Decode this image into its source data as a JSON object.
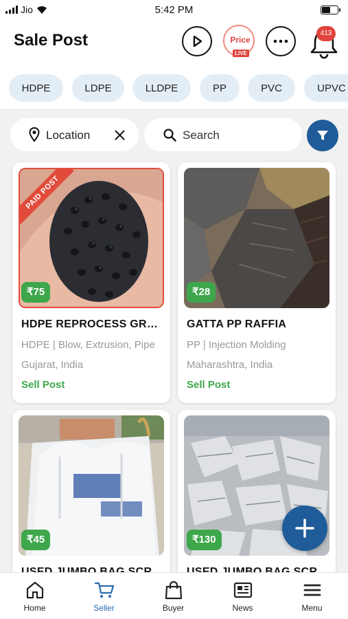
{
  "status_bar": {
    "carrier": "Jio",
    "time": "5:42 PM"
  },
  "header": {
    "title": "Sale Post",
    "price_live": {
      "label": "Price",
      "badge": "LIVE"
    },
    "notification_count": "413"
  },
  "categories": [
    "HDPE",
    "LDPE",
    "LLDPE",
    "PP",
    "PVC",
    "UPVC"
  ],
  "filters": {
    "location_label": "Location",
    "search_label": "Search"
  },
  "posts": [
    {
      "price": "₹75",
      "title": "HDPE REPROCESS GRANULES",
      "subtitle": "HDPE | Blow, Extrusion, Pipe",
      "location": "Gujarat, India",
      "type": "Sell Post",
      "ribbon": "PAID POST"
    },
    {
      "price": "₹28",
      "title": "GATTA PP RAFFIA",
      "subtitle": "PP | Injection Molding",
      "location": "Maharashtra, India",
      "type": "Sell Post"
    },
    {
      "price": "₹45",
      "title": "USED JUMBO BAG SCRAP"
    },
    {
      "price": "₹130",
      "title": "USED JUMBO BAG SCRAP"
    }
  ],
  "bottom_nav": [
    {
      "label": "Home",
      "icon": "home-icon"
    },
    {
      "label": "Seller",
      "icon": "cart-icon",
      "active": true
    },
    {
      "label": "Buyer",
      "icon": "shopping-bag-icon"
    },
    {
      "label": "News",
      "icon": "newspaper-icon"
    },
    {
      "label": "Menu",
      "icon": "menu-icon"
    }
  ],
  "colors": {
    "primary": "#1f5c99",
    "green": "#3ea74b",
    "red": "#e0433d",
    "chip_bg": "#e3edf5"
  }
}
